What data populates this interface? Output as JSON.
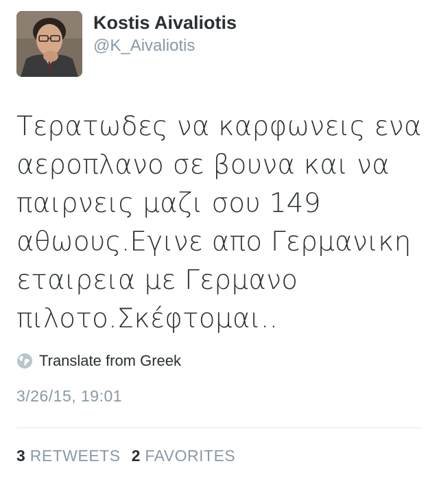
{
  "tweet": {
    "author": {
      "display_name": "Kostis Aivaliotis",
      "handle": "@K_Aivaliotis",
      "avatar_icon": "profile-photo"
    },
    "text_lines": [
      "Τερατωδες να καρφωνεις ενα",
      "αεροπλανο σε βουνα και να",
      "παιρνεις μαζι σου 149",
      "αθωους.Εγινε απο Γερμανικη",
      "εταιρεια με Γερμανο",
      "πιλοτο.Σκέφτομαι.."
    ],
    "translate": {
      "icon": "globe-icon",
      "label": "Translate from Greek"
    },
    "timestamp": "3/26/15, 19:01",
    "stats": {
      "retweets_count": "3",
      "retweets_label": "RETWEETS",
      "favorites_count": "2",
      "favorites_label": "FAVORITES"
    }
  },
  "colors": {
    "text_primary": "#292f33",
    "text_secondary": "#8899a6",
    "divider": "#e1e8ed",
    "background": "#ffffff"
  }
}
